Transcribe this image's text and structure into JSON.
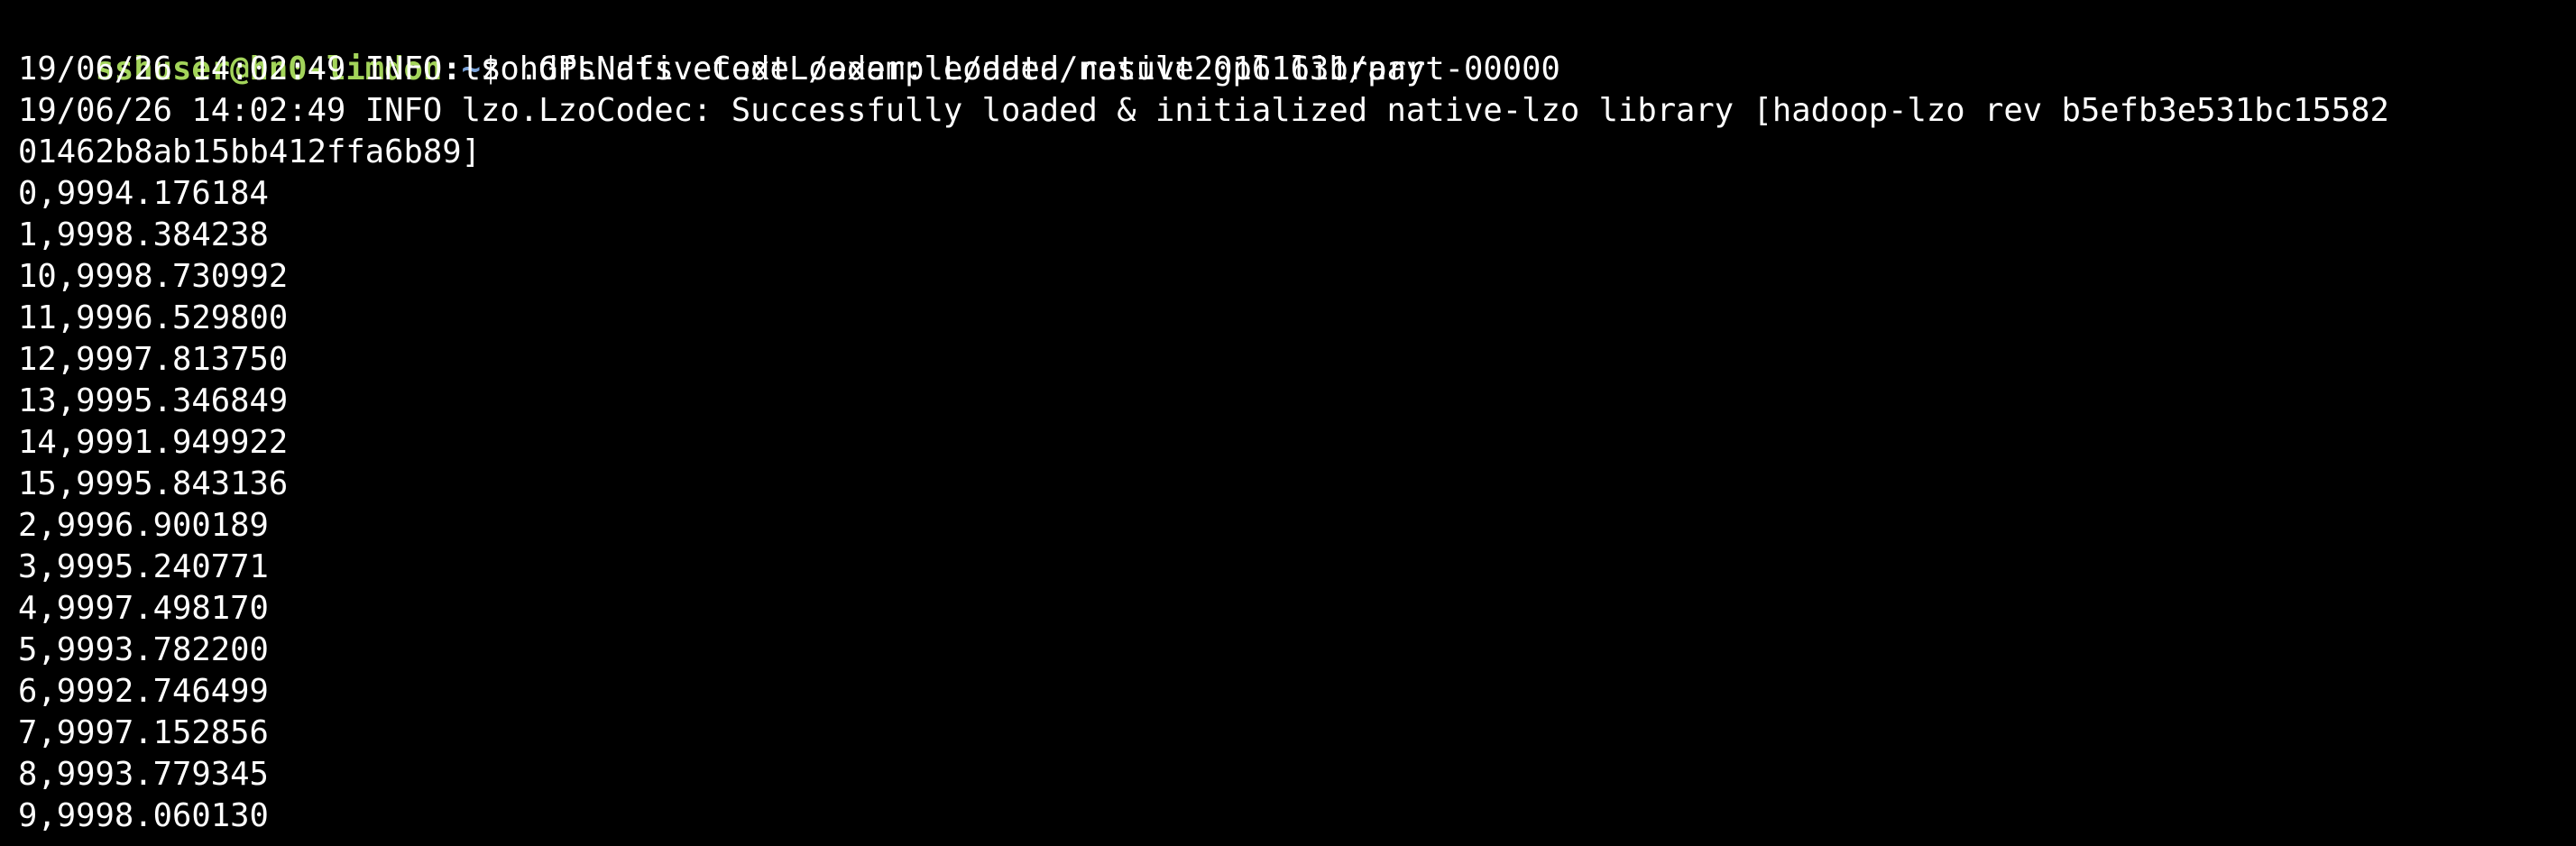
{
  "prompt": {
    "user_host": "sshuser@hn0-limdon",
    "separator": ":",
    "path": "~",
    "symbol": "$ ",
    "command": "hdfs dfs -text /example/data/result20161631/part-00000"
  },
  "log_lines": [
    "19/06/26 14:02:49 INFO lzo.GPLNativeCodeLoader: Loaded native gpl library",
    "19/06/26 14:02:49 INFO lzo.LzoCodec: Successfully loaded & initialized native-lzo library [hadoop-lzo rev b5efb3e531bc15582",
    "01462b8ab15bb412ffa6b89]"
  ],
  "output_rows": [
    "0,9994.176184",
    "1,9998.384238",
    "10,9998.730992",
    "11,9996.529800",
    "12,9997.813750",
    "13,9995.346849",
    "14,9991.949922",
    "15,9995.843136",
    "2,9996.900189",
    "3,9995.240771",
    "4,9997.498170",
    "5,9993.782200",
    "6,9992.746499",
    "7,9997.152856",
    "8,9993.779345",
    "9,9998.060130"
  ],
  "colors": {
    "background": "#000000",
    "text": "#ffffff",
    "user_host": "#a3d45a",
    "path": "#7ba3d9"
  }
}
